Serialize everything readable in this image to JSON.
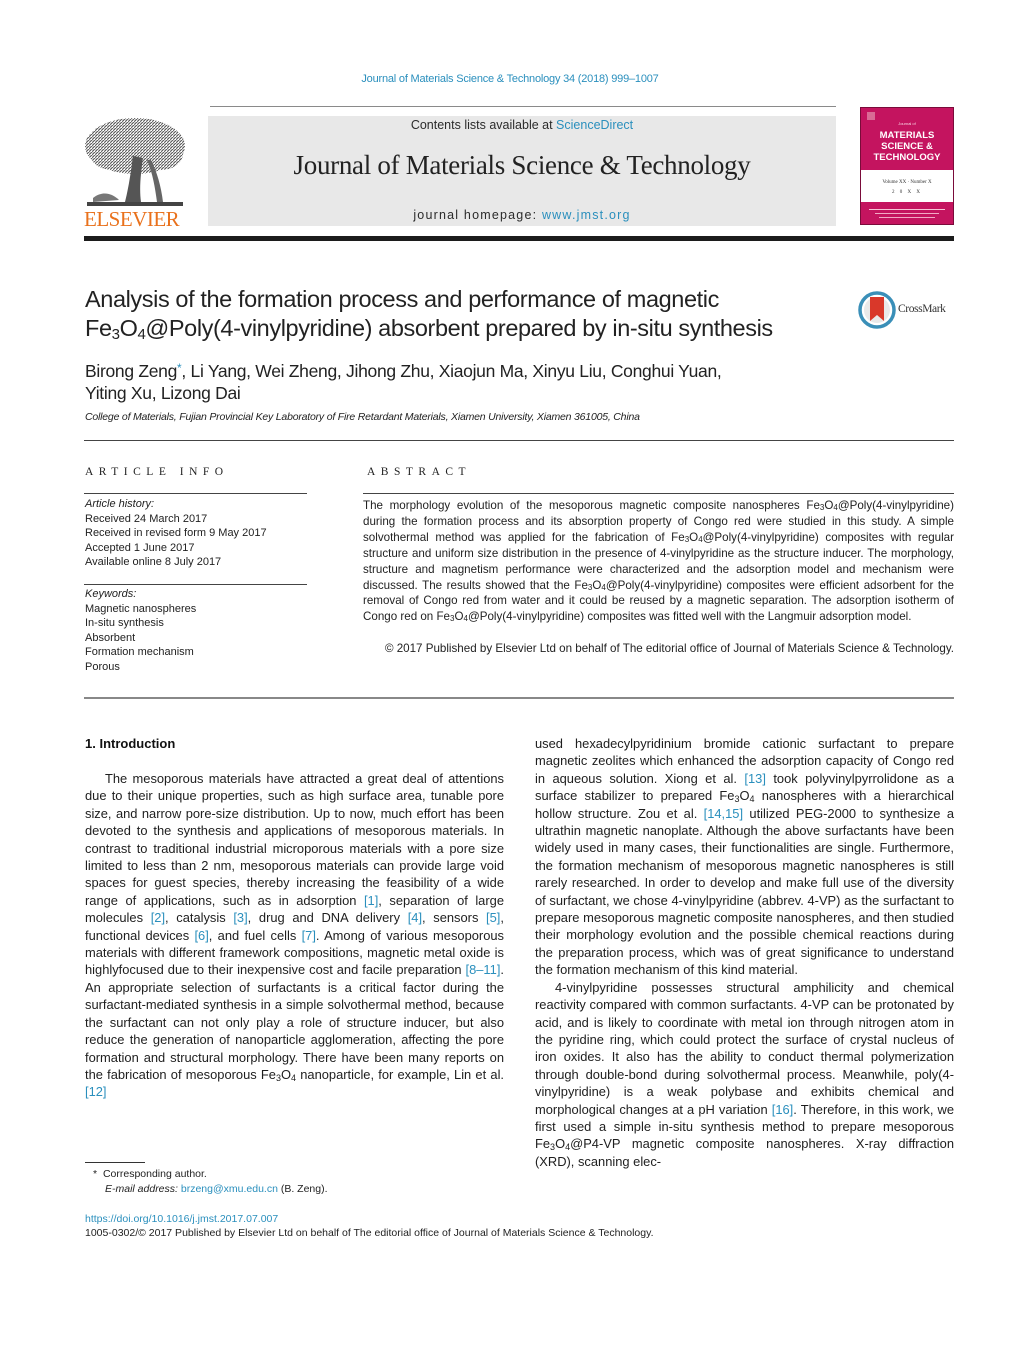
{
  "citation": "Journal of Materials Science & Technology 34 (2018) 999–1007",
  "masthead": {
    "contents_prefix": "Contents lists available at ",
    "contents_link": "ScienceDirect",
    "journal_name": "Journal of Materials Science & Technology",
    "homepage_prefix": "journal homepage: ",
    "homepage_link": "www.jmst.org"
  },
  "publisher_logo": {
    "wordmark": "ELSEVIER",
    "color": "#e9711c"
  },
  "cover": {
    "small_text": "Journal of",
    "title_lines": [
      "MATERIALS",
      "SCIENCE &",
      "TECHNOLOGY"
    ],
    "volume_text": "Volume XX · Number X",
    "year_text": "2 0 X X",
    "color": "#c4145f"
  },
  "crossmark": {
    "label": "CrossMark"
  },
  "article": {
    "title_line1": "Analysis of the formation process and performance of magnetic",
    "title_line2_pre": "Fe",
    "title_line2_sub1": "3",
    "title_line2_mid": "O",
    "title_line2_sub2": "4",
    "title_line2_post": "@Poly(4-vinylpyridine) absorbent prepared by in-situ synthesis",
    "corresponding_author": "Birong Zeng",
    "corresponding_marker": "*",
    "authors_rest_line1": ", Li Yang, Wei Zheng, Jihong Zhu, Xiaojun Ma, Xinyu Liu, Conghui Yuan,",
    "authors_line2": "Yiting Xu, Lizong Dai",
    "affiliation": "College of Materials, Fujian Provincial Key Laboratory of Fire Retardant Materials, Xiamen University, Xiamen 361005, China"
  },
  "article_info": {
    "heading": "ARTICLE INFO",
    "history_label": "Article history:",
    "history": [
      "Received 24 March 2017",
      "Received in revised form 9 May 2017",
      "Accepted 1 June 2017",
      "Available online 8 July 2017"
    ],
    "keywords_label": "Keywords:",
    "keywords": [
      "Magnetic nanospheres",
      "In-situ synthesis",
      "Absorbent",
      "Formation mechanism",
      "Porous"
    ]
  },
  "abstract": {
    "heading": "ABSTRACT",
    "s1": "The morphology evolution of the mesoporous magnetic composite nanospheres Fe",
    "s2": "@Poly(4-vinylpyridine) during the formation process and its absorption property of Congo red were studied in this study. A simple solvothermal method was applied for the fabrication of Fe",
    "s3": "@Poly(4-vinylpyridine) composites with regular structure and uniform size distribution in the presence of 4-vinylpyridine as the structure inducer. The morphology, structure and magnetism performance were characterized and the adsorption model and mechanism were discussed. The results showed that the Fe",
    "s4": "@Poly(4-vinylpyridine) composites were efficient adsorbent for the removal of Congo red from water and it could be reused by a magnetic separation. The adsorption isotherm of Congo red on Fe",
    "s5": "@Poly(4-vinylpyridine) composites was fitted well with the Langmuir adsorption model.",
    "copyright": "© 2017 Published by Elsevier Ltd on behalf of The editorial office of Journal of Materials Science & Technology."
  },
  "intro": {
    "heading": "1.  Introduction",
    "p1_a": "The mesoporous materials have attracted a great deal of attentions due to their unique properties, such as high surface area, tunable pore size, and narrow pore-size distribution. Up to now, much effort has been devoted to the synthesis and applications of mesoporous materials. In contrast to traditional industrial microporous materials with a pore size limited to less than 2 nm, mesoporous materials can provide large void spaces for guest species, thereby increasing the feasibility of a wide range of applications, such as in adsorption ",
    "ref1": "[1]",
    "p1_b": ", separation of large molecules ",
    "ref2": "[2]",
    "p1_c": ", catalysis ",
    "ref3": "[3]",
    "p1_d": ", drug and DNA delivery ",
    "ref4": "[4]",
    "p1_e": ", sensors ",
    "ref5": "[5]",
    "p1_f": ", functional devices ",
    "ref6": "[6]",
    "p1_g": ", and fuel cells ",
    "ref7": "[7]",
    "p1_h": ". Among of various mesoporous materials with different framework compositions, magnetic metal oxide is highlyfocused due to their inexpensive cost and facile preparation ",
    "ref8": "[8–11]",
    "p1_i": ". An appropriate selection of surfactants is a critical factor during the surfactant-mediated synthesis in a simple solvothermal method, because the surfactant can not only play a role of structure inducer, but also reduce the generation of nanoparticle agglomeration, affecting the pore formation and structural morphology. There have been many reports on the fabrication of mesoporous Fe",
    "p1_j": " nanoparticle, for example, Lin et al. ",
    "ref12": "[12]",
    "p1_k": " used hexadecylpyridinium bromide cationic surfactant to prepare magnetic zeolites which enhanced the adsorption capacity of Congo red in aqueous solution. Xiong et al. ",
    "ref13": "[13]",
    "p1_l": " took polyvinylpyrrolidone as a surface stabilizer to prepared Fe",
    "p1_m": " nanospheres with a hierarchical hollow structure. Zou et al. ",
    "ref14": "[14,15]",
    "p1_n": " utilized PEG-2000 to synthesize a ultrathin magnetic nanoplate. Although the above surfactants have been widely used in many cases, their functionalities are single. Furthermore, the formation mechanism of mesoporous magnetic nanospheres is still rarely researched. In order to develop and make full use of the diversity of surfactant, we chose 4-vinylpyridine (abbrev. 4-VP) as the surfactant to prepare mesoporous magnetic composite nanospheres, and then studied their morphology evolution and the possible chemical reactions during the preparation process, which was of great significance to understand the formation mechanism of this kind material.",
    "p2_a": "4-vinylpyridine possesses structural amphilicity and chemical reactivity compared with common surfactants. 4-VP can be protonated by acid, and is likely to coordinate with metal ion through nitrogen atom in the pyridine ring, which could protect the surface of crystal nucleus of iron oxides. It also has the ability to conduct thermal polymerization through double-bond during solvothermal process. Meanwhile, poly(4-vinylpyridine) is a weak polybase and exhibits chemical and morphological changes at a pH variation ",
    "ref16": "[16]",
    "p2_b": ". Therefore, in this work, we first used a simple in-situ synthesis method to prepare mesoporous Fe",
    "p2_c": "@P4-VP magnetic composite nanospheres. X-ray diffraction (XRD), scanning elec-",
    "sub3": "3",
    "sub4": "4",
    "O": "O"
  },
  "footnote": {
    "marker": "*",
    "corresponding": "Corresponding author.",
    "email_label": "E-mail address:",
    "email": "brzeng@xmu.edu.cn",
    "email_suffix": " (B. Zeng)."
  },
  "doi": "https://doi.org/10.1016/j.jmst.2017.07.007",
  "issn_line": "1005-0302/© 2017 Published by Elsevier Ltd on behalf of The editorial office of Journal of Materials Science & Technology.",
  "colors": {
    "link": "#2a8fbd",
    "elsevier_orange": "#e9711c",
    "cover_magenta": "#c4145f",
    "masthead_bg": "#e8e8e8"
  }
}
